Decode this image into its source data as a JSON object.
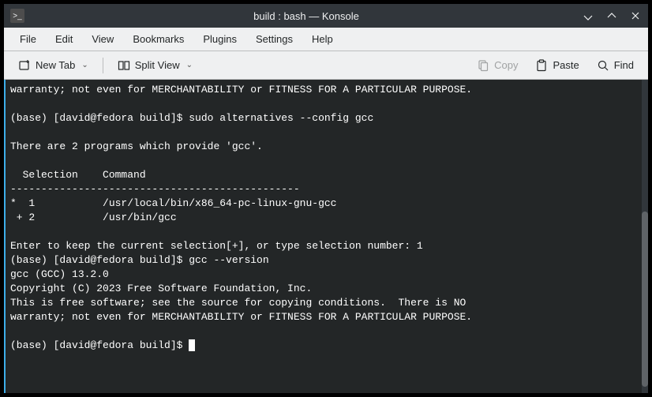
{
  "window": {
    "title": "build : bash — Konsole"
  },
  "menubar": {
    "file": "File",
    "edit": "Edit",
    "view": "View",
    "bookmarks": "Bookmarks",
    "plugins": "Plugins",
    "settings": "Settings",
    "help": "Help"
  },
  "toolbar": {
    "new_tab": "New Tab",
    "split_view": "Split View",
    "copy": "Copy",
    "paste": "Paste",
    "find": "Find"
  },
  "terminal": {
    "lines": [
      "warranty; not even for MERCHANTABILITY or FITNESS FOR A PARTICULAR PURPOSE.",
      "",
      "(base) [david@fedora build]$ sudo alternatives --config gcc",
      "",
      "There are 2 programs which provide 'gcc'.",
      "",
      "  Selection    Command",
      "-----------------------------------------------",
      "*  1           /usr/local/bin/x86_64-pc-linux-gnu-gcc",
      " + 2           /usr/bin/gcc",
      "",
      "Enter to keep the current selection[+], or type selection number: 1",
      "(base) [david@fedora build]$ gcc --version",
      "gcc (GCC) 13.2.0",
      "Copyright (C) 2023 Free Software Foundation, Inc.",
      "This is free software; see the source for copying conditions.  There is NO",
      "warranty; not even for MERCHANTABILITY or FITNESS FOR A PARTICULAR PURPOSE.",
      "",
      "(base) [david@fedora build]$ "
    ]
  },
  "scrollbar": {
    "thumb_top_pct": 42,
    "thumb_height_pct": 56
  }
}
